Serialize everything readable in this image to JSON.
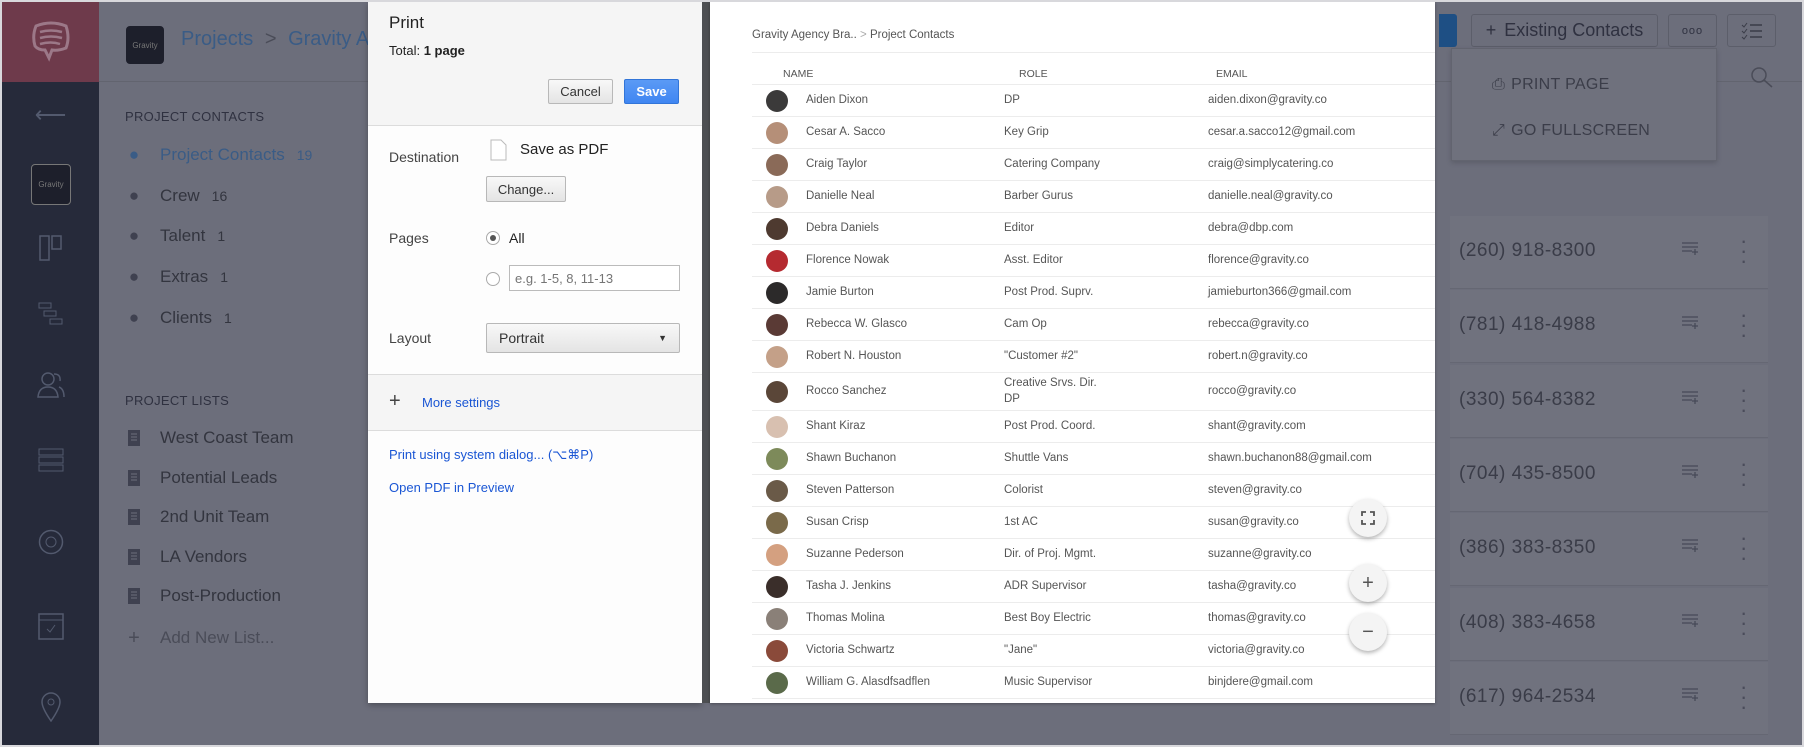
{
  "app": {
    "logo_box_label": "Gravity",
    "breadcrumb": {
      "root": "Projects",
      "separator": ">",
      "current": "Gravity Agen"
    }
  },
  "sidebar": {
    "icons": [
      "back-arrow-icon",
      "gravity-project-icon",
      "board-icon",
      "timeline-icon",
      "contacts-icon",
      "list-icon",
      "aperture-icon",
      "calendar-icon",
      "location-pin-icon",
      "folder-icon"
    ]
  },
  "panel": {
    "contacts_heading": "PROJECT CONTACTS",
    "contacts": [
      {
        "label": "Project Contacts",
        "count": "19",
        "icon": "group-icon",
        "active": true
      },
      {
        "label": "Crew",
        "count": "16",
        "icon": "crew-icon"
      },
      {
        "label": "Talent",
        "count": "1",
        "icon": "mask-icon"
      },
      {
        "label": "Extras",
        "count": "1",
        "icon": "extras-icon"
      },
      {
        "label": "Clients",
        "count": "1",
        "icon": "client-icon"
      }
    ],
    "lists_heading": "PROJECT LISTS",
    "lists": [
      {
        "label": "West Coast Team"
      },
      {
        "label": "Potential Leads"
      },
      {
        "label": "2nd Unit Team"
      },
      {
        "label": "LA Vendors"
      },
      {
        "label": "Post-Production"
      }
    ],
    "add_list": "Add New List..."
  },
  "print_dialog": {
    "title": "Print",
    "total_label": "Total:",
    "total_value": "1 page",
    "cancel": "Cancel",
    "save": "Save",
    "destination_label": "Destination",
    "destination_value": "Save as PDF",
    "change": "Change...",
    "pages_label": "Pages",
    "pages_all": "All",
    "pages_placeholder": "e.g. 1-5, 8, 11-13",
    "layout_label": "Layout",
    "layout_value": "Portrait",
    "more_settings": "More settings",
    "system_dialog": "Print using system dialog... (⌥⌘P)",
    "open_pdf": "Open PDF in Preview"
  },
  "preview": {
    "breadcrumb_parent": "Gravity Agency Bra..",
    "breadcrumb_sep": ">",
    "breadcrumb_current": "Project Contacts",
    "columns": [
      "NAME",
      "ROLE",
      "EMAIL"
    ],
    "rows": [
      {
        "name": "Aiden Dixon",
        "role": "DP",
        "email": "aiden.dixon@gravity.co",
        "avatar_color": "#3b3a3a"
      },
      {
        "name": "Cesar A. Sacco",
        "role": "Key Grip",
        "email": "cesar.a.sacco12@gmail.com",
        "avatar_color": "#b58f78"
      },
      {
        "name": "Craig Taylor",
        "role": "Catering Company",
        "email": "craig@simplycatering.co",
        "avatar_color": "#8a6a58"
      },
      {
        "name": "Danielle Neal",
        "role": "Barber Gurus",
        "email": "danielle.neal@gravity.co",
        "avatar_color": "#b79b88"
      },
      {
        "name": "Debra Daniels",
        "role": "Editor",
        "email": "debra@dbp.com",
        "avatar_color": "#4e3a30"
      },
      {
        "name": "Florence Nowak",
        "role": "Asst. Editor",
        "email": "florence@gravity.co",
        "avatar_color": "#b52a30"
      },
      {
        "name": "Jamie Burton",
        "role": "Post Prod. Suprv.",
        "email": "jamieburton366@gmail.com",
        "avatar_color": "#2c2a2a"
      },
      {
        "name": "Rebecca W. Glasco",
        "role": "Cam Op",
        "email": "rebecca@gravity.co",
        "avatar_color": "#5a3a35"
      },
      {
        "name": "Robert N. Houston",
        "role": "\"Customer #2\"",
        "email": "robert.n@gravity.co",
        "avatar_color": "#c4a088"
      },
      {
        "name": "Rocco Sanchez",
        "role": "Creative Srvs. Dir.",
        "role_line2": "DP",
        "email": "rocco@gravity.co",
        "avatar_color": "#5a4638"
      },
      {
        "name": "Shant Kiraz",
        "role": "Post Prod. Coord.",
        "email": "shant@gravity.com",
        "avatar_color": "#d8c0b0"
      },
      {
        "name": "Shawn Buchanon",
        "role": "Shuttle Vans",
        "email": "shawn.buchanon88@gmail.com",
        "avatar_color": "#7d8a5a"
      },
      {
        "name": "Steven Patterson",
        "role": "Colorist",
        "email": "steven@gravity.co",
        "avatar_color": "#6a5a48"
      },
      {
        "name": "Susan Crisp",
        "role": "1st AC",
        "email": "susan@gravity.co",
        "avatar_color": "#7a6a4a"
      },
      {
        "name": "Suzanne Pederson",
        "role": "Dir. of Proj. Mgmt.",
        "email": "suzanne@gravity.co",
        "avatar_color": "#d4a080"
      },
      {
        "name": "Tasha J. Jenkins",
        "role": "ADR Supervisor",
        "email": "tasha@gravity.co",
        "avatar_color": "#3a2e2a"
      },
      {
        "name": "Thomas Molina",
        "role": "Best Boy Electric",
        "email": "thomas@gravity.co",
        "avatar_color": "#8a8078"
      },
      {
        "name": "Victoria Schwartz",
        "role": "\"Jane\"",
        "email": "victoria@gravity.co",
        "avatar_color": "#8a4a3a"
      },
      {
        "name": "William G. Alasdfsadflen",
        "role": "Music Supervisor",
        "email": "binjdere@gmail.com",
        "avatar_color": "#5a6a4a"
      }
    ],
    "zoom_controls": {
      "fullscreen_icon": "fullscreen-icon",
      "zoom_in": "+",
      "zoom_out": "−"
    }
  },
  "toolbar": {
    "existing_contacts": "Existing Contacts",
    "more_icon": "ooo",
    "checklist_icon": "checklist-icon"
  },
  "menu": {
    "print_page": "PRINT PAGE",
    "go_fullscreen": "GO FULLSCREEN"
  },
  "phones": [
    "(260) 918-8300",
    "(781) 418-4988",
    "(330) 564-8382",
    "(704) 435-8500",
    "(386) 383-8350",
    "(408) 383-4658",
    "(617) 964-2534"
  ],
  "colors": {
    "accent_blue": "#4a8af4",
    "link_blue": "#1a56d4",
    "sidebar": "#262a3a",
    "brand": "#6e3a4b"
  }
}
